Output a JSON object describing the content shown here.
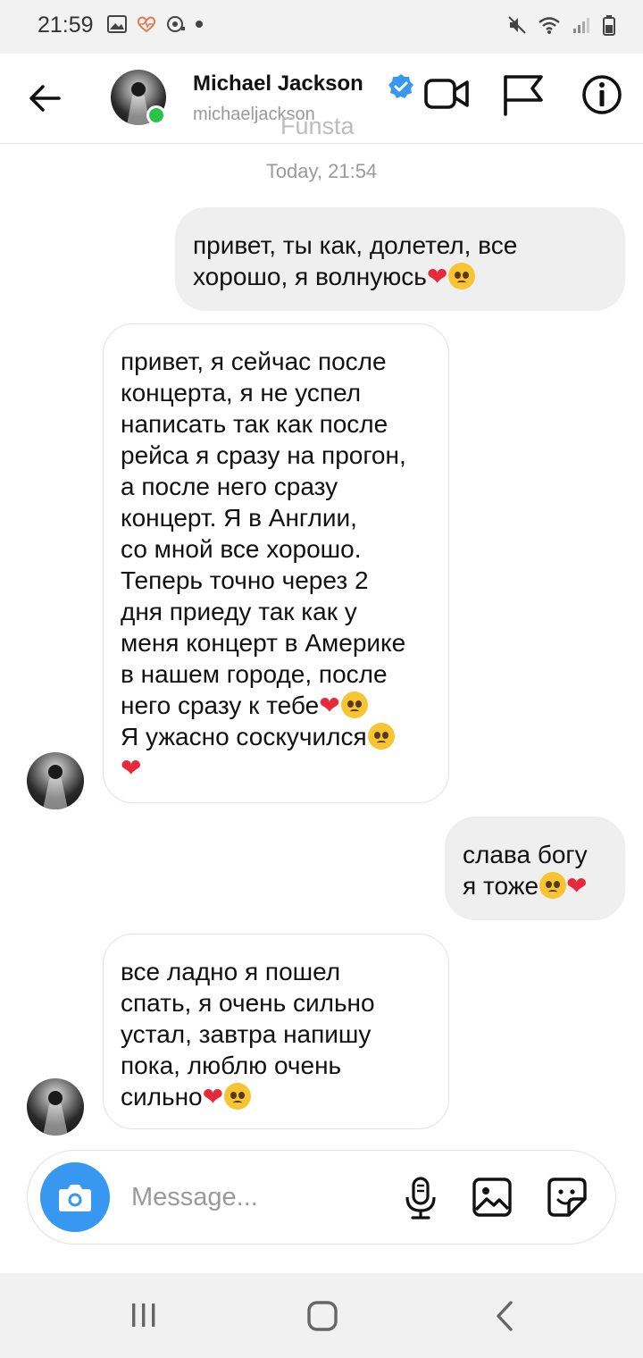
{
  "status": {
    "time": "21:59"
  },
  "header": {
    "name": "Michael Jackson",
    "handle": "michaeljackson",
    "watermark": "Funsta",
    "icons": {
      "back": "back-arrow-icon",
      "verified": "verified-badge-icon",
      "video": "video-camera-icon",
      "flag": "flag-icon",
      "info": "info-icon"
    }
  },
  "thread": {
    "timestamp": "Today, 21:54",
    "messages": [
      {
        "direction": "out",
        "lines": [
          "привет, ты как, долетел, все",
          "хорошо, я волнуюсь"
        ]
      },
      {
        "direction": "in",
        "lines": [
          "привет, я сейчас после",
          "концерта, я не успел",
          "написать так как после",
          "рейса я сразу на прогон,",
          "а после него сразу",
          "концерт. Я в Англии,",
          "со мной все хорошо.",
          "Теперь точно через 2",
          "дня приеду так как у",
          "меня концерт в Америке",
          "в нашем городе, после",
          "него сразу к тебе",
          "Я ужасно соскучился",
          ""
        ]
      },
      {
        "direction": "out",
        "lines": [
          "слава богу",
          "я тоже"
        ]
      },
      {
        "direction": "in",
        "lines": [
          "все ладно я пошел",
          "спать, я очень сильно",
          "устал, завтра напишу",
          "пока, люблю очень",
          "сильно"
        ]
      }
    ]
  },
  "composer": {
    "placeholder": "Message...",
    "icons": {
      "camera": "camera-icon",
      "mic": "microphone-icon",
      "gallery": "image-icon",
      "sticker": "sticker-icon"
    }
  },
  "navbar": {
    "icons": [
      "recent-apps-icon",
      "home-icon",
      "back-icon"
    ]
  }
}
